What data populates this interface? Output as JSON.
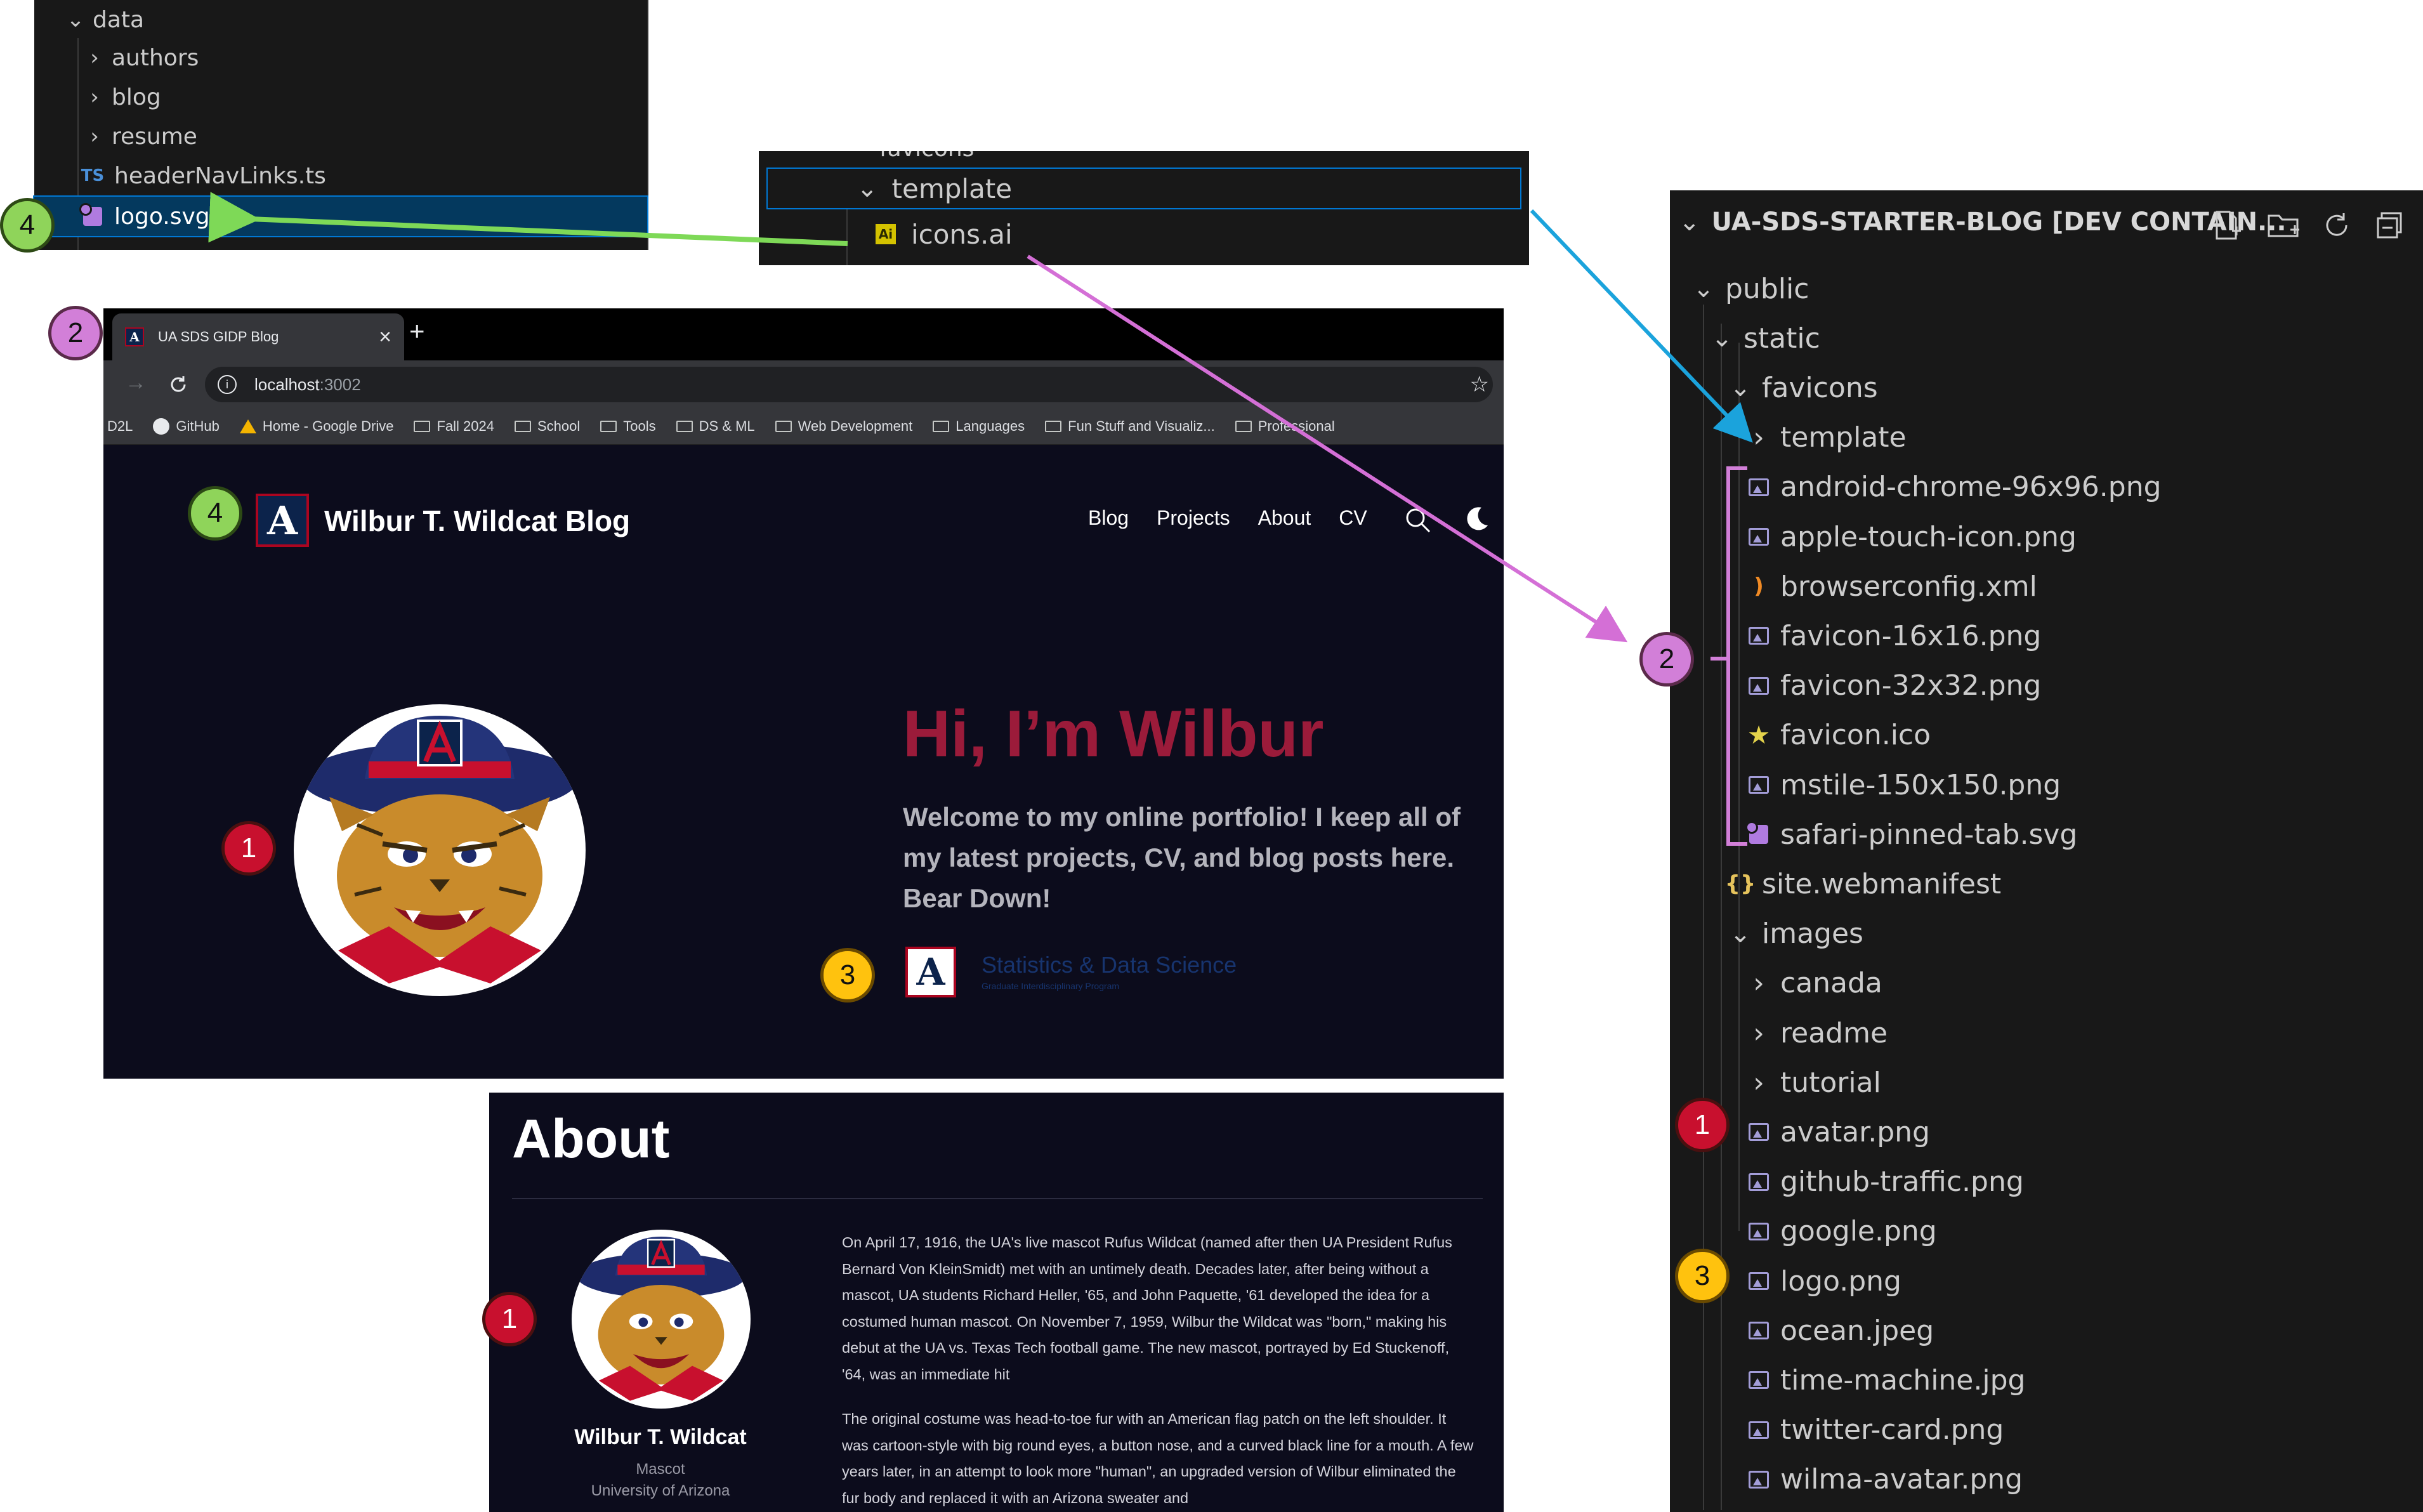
{
  "explorer_top": {
    "items": [
      {
        "label": "data",
        "type": "folder-open"
      },
      {
        "label": "authors",
        "type": "folder"
      },
      {
        "label": "blog",
        "type": "folder"
      },
      {
        "label": "resume",
        "type": "folder"
      },
      {
        "label": "headerNavLinks.ts",
        "icon": "TS"
      },
      {
        "label": "logo.svg",
        "selected": true
      }
    ]
  },
  "explorer_mid": {
    "cut_label": "favicons",
    "template_label": "template",
    "file_label": "icons.ai",
    "ai_icon": "Ai"
  },
  "explorer_right": {
    "title": "UA-SDS-STARTER-BLOG [DEV CONTAIN...",
    "items": [
      {
        "label": "public",
        "depth": 1,
        "kind": "folder-open"
      },
      {
        "label": "static",
        "depth": 2,
        "kind": "folder-open"
      },
      {
        "label": "favicons",
        "depth": 3,
        "kind": "folder-open"
      },
      {
        "label": "template",
        "depth": 4,
        "kind": "folder"
      },
      {
        "label": "android-chrome-96x96.png",
        "depth": 4,
        "kind": "image"
      },
      {
        "label": "apple-touch-icon.png",
        "depth": 4,
        "kind": "image"
      },
      {
        "label": "browserconfig.xml",
        "depth": 4,
        "kind": "rss"
      },
      {
        "label": "favicon-16x16.png",
        "depth": 4,
        "kind": "image"
      },
      {
        "label": "favicon-32x32.png",
        "depth": 4,
        "kind": "image"
      },
      {
        "label": "favicon.ico",
        "depth": 4,
        "kind": "star"
      },
      {
        "label": "mstile-150x150.png",
        "depth": 4,
        "kind": "image"
      },
      {
        "label": "safari-pinned-tab.svg",
        "depth": 4,
        "kind": "svg"
      },
      {
        "label": "site.webmanifest",
        "depth": 3,
        "kind": "json"
      },
      {
        "label": "images",
        "depth": 3,
        "kind": "folder-open"
      },
      {
        "label": "canada",
        "depth": 4,
        "kind": "folder"
      },
      {
        "label": "readme",
        "depth": 4,
        "kind": "folder"
      },
      {
        "label": "tutorial",
        "depth": 4,
        "kind": "folder"
      },
      {
        "label": "avatar.png",
        "depth": 4,
        "kind": "image"
      },
      {
        "label": "github-traffic.png",
        "depth": 4,
        "kind": "image"
      },
      {
        "label": "google.png",
        "depth": 4,
        "kind": "image"
      },
      {
        "label": "logo.png",
        "depth": 4,
        "kind": "image"
      },
      {
        "label": "ocean.jpeg",
        "depth": 4,
        "kind": "image"
      },
      {
        "label": "time-machine.jpg",
        "depth": 4,
        "kind": "image"
      },
      {
        "label": "twitter-card.png",
        "depth": 4,
        "kind": "image"
      },
      {
        "label": "wilma-avatar.png",
        "depth": 4,
        "kind": "image"
      }
    ]
  },
  "browser": {
    "tab_title": "UA SDS GIDP Blog",
    "close": "×",
    "new_tab": "+",
    "url_host": "localhost",
    "url_port": ":3002",
    "star": "☆",
    "bookmarks": [
      {
        "label": "D2L",
        "kind": "plain"
      },
      {
        "label": "GitHub",
        "kind": "github"
      },
      {
        "label": "Home - Google Drive",
        "kind": "drive"
      },
      {
        "label": "Fall 2024",
        "kind": "folder"
      },
      {
        "label": "School",
        "kind": "folder"
      },
      {
        "label": "Tools",
        "kind": "folder"
      },
      {
        "label": "DS & ML",
        "kind": "folder"
      },
      {
        "label": "Web Development",
        "kind": "folder"
      },
      {
        "label": "Languages",
        "kind": "folder"
      },
      {
        "label": "Fun Stuff and Visualiz...",
        "kind": "folder"
      },
      {
        "label": "Professional",
        "kind": "folder"
      }
    ]
  },
  "site": {
    "title": "Wilbur T. Wildcat Blog",
    "nav": [
      "Blog",
      "Projects",
      "About",
      "CV"
    ],
    "hero_heading": "Hi, I’m Wilbur",
    "hero_text": "Welcome to my online portfolio! I keep all of my latest projects, CV, and blog posts here. Bear Down!",
    "sds_name": "Statistics & Data Science",
    "sds_sub": "Graduate Interdisciplinary Program",
    "logo_letter": "A"
  },
  "about": {
    "heading": "About",
    "name": "Wilbur T. Wildcat",
    "role": "Mascot",
    "org": "University of Arizona",
    "para1": "On April 17, 1916, the UA's live mascot Rufus Wildcat (named after then UA President Rufus Bernard Von KleinSmidt) met with an untimely death. Decades later, after being without a mascot, UA students Richard Heller, '65, and John Paquette, '61 developed the idea for a costumed human mascot. On November 7, 1959, Wilbur the Wildcat was \"born,\" making his debut at the UA vs. Texas Tech football game. The new mascot, portrayed by Ed Stuckenoff, '64, was an immediate hit",
    "para2": "The original costume was head-to-toe fur with an American flag patch on the left shoulder. It was cartoon-style with big round eyes, a button nose, and a curved black line for a mouth. A few years later, in an attempt to look more \"human\", an upgraded version of Wilbur eliminated the fur body and replaced it with an Arizona sweater and"
  },
  "badges": {
    "one": "1",
    "two": "2",
    "three": "3",
    "four": "4"
  },
  "colors": {
    "vscode_bg": "#181818",
    "selection": "#04395e",
    "site_bg": "#0c0c1c",
    "hero_red": "#9b1b3a",
    "ua_navy": "#0c234b",
    "ua_red": "#ab0520",
    "arrow_green": "#7ed957",
    "arrow_pink": "#d46fd6",
    "arrow_blue": "#1ba3dc",
    "bracket_pink": "#d27fd8"
  },
  "icons": [
    "chevron-down-icon",
    "chevron-right-icon",
    "image-file-icon",
    "svg-file-icon",
    "ts-file-icon",
    "ai-file-icon",
    "rss-icon",
    "favicon-star-icon",
    "json-icon",
    "new-file-icon",
    "new-folder-icon",
    "refresh-icon",
    "collapse-all-icon",
    "search-icon",
    "moon-icon",
    "info-icon",
    "reload-icon",
    "forward-icon",
    "bookmark-star-icon",
    "github-icon",
    "google-drive-icon",
    "folder-icon"
  ]
}
